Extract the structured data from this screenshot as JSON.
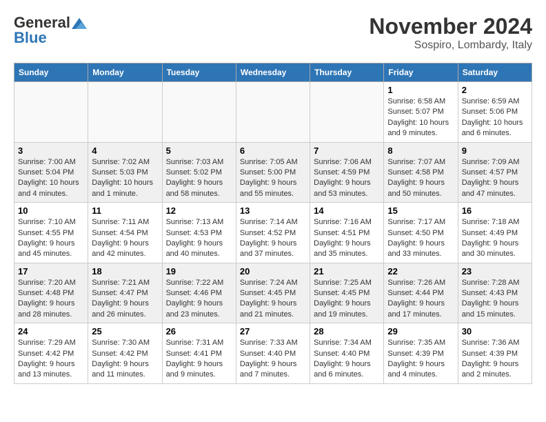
{
  "header": {
    "logo_line1": "General",
    "logo_line2": "Blue",
    "month_title": "November 2024",
    "location": "Sospiro, Lombardy, Italy"
  },
  "weekdays": [
    "Sunday",
    "Monday",
    "Tuesday",
    "Wednesday",
    "Thursday",
    "Friday",
    "Saturday"
  ],
  "weeks": [
    [
      {
        "day": "",
        "info": ""
      },
      {
        "day": "",
        "info": ""
      },
      {
        "day": "",
        "info": ""
      },
      {
        "day": "",
        "info": ""
      },
      {
        "day": "",
        "info": ""
      },
      {
        "day": "1",
        "info": "Sunrise: 6:58 AM\nSunset: 5:07 PM\nDaylight: 10 hours and 9 minutes."
      },
      {
        "day": "2",
        "info": "Sunrise: 6:59 AM\nSunset: 5:06 PM\nDaylight: 10 hours and 6 minutes."
      }
    ],
    [
      {
        "day": "3",
        "info": "Sunrise: 7:00 AM\nSunset: 5:04 PM\nDaylight: 10 hours and 4 minutes."
      },
      {
        "day": "4",
        "info": "Sunrise: 7:02 AM\nSunset: 5:03 PM\nDaylight: 10 hours and 1 minute."
      },
      {
        "day": "5",
        "info": "Sunrise: 7:03 AM\nSunset: 5:02 PM\nDaylight: 9 hours and 58 minutes."
      },
      {
        "day": "6",
        "info": "Sunrise: 7:05 AM\nSunset: 5:00 PM\nDaylight: 9 hours and 55 minutes."
      },
      {
        "day": "7",
        "info": "Sunrise: 7:06 AM\nSunset: 4:59 PM\nDaylight: 9 hours and 53 minutes."
      },
      {
        "day": "8",
        "info": "Sunrise: 7:07 AM\nSunset: 4:58 PM\nDaylight: 9 hours and 50 minutes."
      },
      {
        "day": "9",
        "info": "Sunrise: 7:09 AM\nSunset: 4:57 PM\nDaylight: 9 hours and 47 minutes."
      }
    ],
    [
      {
        "day": "10",
        "info": "Sunrise: 7:10 AM\nSunset: 4:55 PM\nDaylight: 9 hours and 45 minutes."
      },
      {
        "day": "11",
        "info": "Sunrise: 7:11 AM\nSunset: 4:54 PM\nDaylight: 9 hours and 42 minutes."
      },
      {
        "day": "12",
        "info": "Sunrise: 7:13 AM\nSunset: 4:53 PM\nDaylight: 9 hours and 40 minutes."
      },
      {
        "day": "13",
        "info": "Sunrise: 7:14 AM\nSunset: 4:52 PM\nDaylight: 9 hours and 37 minutes."
      },
      {
        "day": "14",
        "info": "Sunrise: 7:16 AM\nSunset: 4:51 PM\nDaylight: 9 hours and 35 minutes."
      },
      {
        "day": "15",
        "info": "Sunrise: 7:17 AM\nSunset: 4:50 PM\nDaylight: 9 hours and 33 minutes."
      },
      {
        "day": "16",
        "info": "Sunrise: 7:18 AM\nSunset: 4:49 PM\nDaylight: 9 hours and 30 minutes."
      }
    ],
    [
      {
        "day": "17",
        "info": "Sunrise: 7:20 AM\nSunset: 4:48 PM\nDaylight: 9 hours and 28 minutes."
      },
      {
        "day": "18",
        "info": "Sunrise: 7:21 AM\nSunset: 4:47 PM\nDaylight: 9 hours and 26 minutes."
      },
      {
        "day": "19",
        "info": "Sunrise: 7:22 AM\nSunset: 4:46 PM\nDaylight: 9 hours and 23 minutes."
      },
      {
        "day": "20",
        "info": "Sunrise: 7:24 AM\nSunset: 4:45 PM\nDaylight: 9 hours and 21 minutes."
      },
      {
        "day": "21",
        "info": "Sunrise: 7:25 AM\nSunset: 4:45 PM\nDaylight: 9 hours and 19 minutes."
      },
      {
        "day": "22",
        "info": "Sunrise: 7:26 AM\nSunset: 4:44 PM\nDaylight: 9 hours and 17 minutes."
      },
      {
        "day": "23",
        "info": "Sunrise: 7:28 AM\nSunset: 4:43 PM\nDaylight: 9 hours and 15 minutes."
      }
    ],
    [
      {
        "day": "24",
        "info": "Sunrise: 7:29 AM\nSunset: 4:42 PM\nDaylight: 9 hours and 13 minutes."
      },
      {
        "day": "25",
        "info": "Sunrise: 7:30 AM\nSunset: 4:42 PM\nDaylight: 9 hours and 11 minutes."
      },
      {
        "day": "26",
        "info": "Sunrise: 7:31 AM\nSunset: 4:41 PM\nDaylight: 9 hours and 9 minutes."
      },
      {
        "day": "27",
        "info": "Sunrise: 7:33 AM\nSunset: 4:40 PM\nDaylight: 9 hours and 7 minutes."
      },
      {
        "day": "28",
        "info": "Sunrise: 7:34 AM\nSunset: 4:40 PM\nDaylight: 9 hours and 6 minutes."
      },
      {
        "day": "29",
        "info": "Sunrise: 7:35 AM\nSunset: 4:39 PM\nDaylight: 9 hours and 4 minutes."
      },
      {
        "day": "30",
        "info": "Sunrise: 7:36 AM\nSunset: 4:39 PM\nDaylight: 9 hours and 2 minutes."
      }
    ]
  ]
}
